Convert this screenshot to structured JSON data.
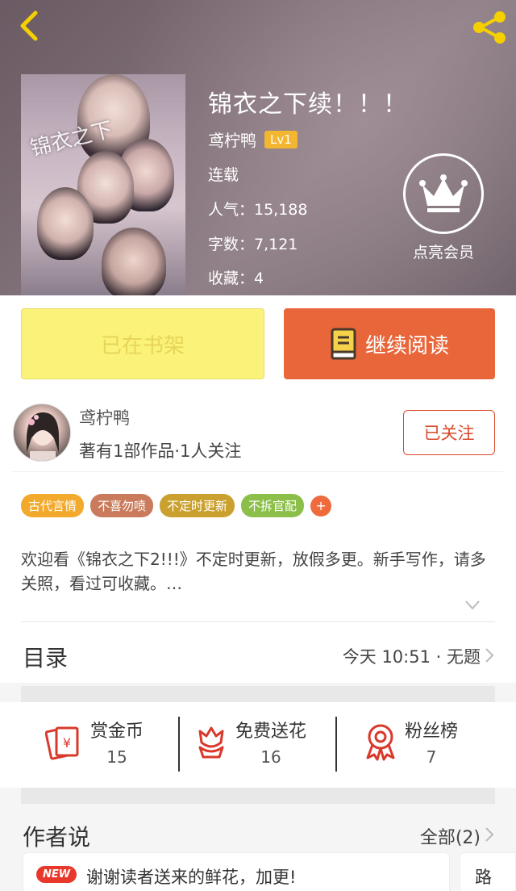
{
  "header": {
    "back_icon": "chevron-left-icon",
    "share_icon": "share-icon"
  },
  "book": {
    "title": "锦衣之下续！！！",
    "author": "鸢柠鸭",
    "level": "Lv1",
    "status": "连载",
    "popularity": "人气：15,188",
    "word_count": "字数：7,121",
    "favorites": "收藏：4"
  },
  "vip": {
    "label": "点亮会员",
    "icon": "crown-icon"
  },
  "actions": {
    "shelf_label": "已在书架",
    "read_label": "继续阅读"
  },
  "author": {
    "name": "鸢柠鸭",
    "stats": "著有1部作品·1人关注",
    "follow_label": "已关注"
  },
  "tags": [
    {
      "label": "古代言情",
      "color": "#f2a92c"
    },
    {
      "label": "不喜勿喷",
      "color": "#c97b5b"
    },
    {
      "label": "不定时更新",
      "color": "#caa02e"
    },
    {
      "label": "不拆官配",
      "color": "#8cbf4a"
    }
  ],
  "tag_add": "+",
  "synopsis": "欢迎看《锦衣之下2!!!》不定时更新，放假多更。新手写作，请多关照，看过可收藏。…",
  "toc": {
    "label": "目录",
    "latest": "今天 10:51 · 无题"
  },
  "stats": {
    "reward": {
      "label": "赏金币",
      "value": "15"
    },
    "flowers": {
      "label": "免费送花",
      "value": "16"
    },
    "fans": {
      "label": "粉丝榜",
      "value": "7"
    }
  },
  "author_says": {
    "title": "作者说",
    "all_label": "全部(2)",
    "cards": [
      {
        "badge": "NEW",
        "text": "谢谢读者送来的鲜花，加更!"
      },
      {
        "text": "路"
      }
    ]
  },
  "colors": {
    "accent": "#e8663a",
    "shelf": "#fbf27a",
    "follow": "#d9492b"
  }
}
